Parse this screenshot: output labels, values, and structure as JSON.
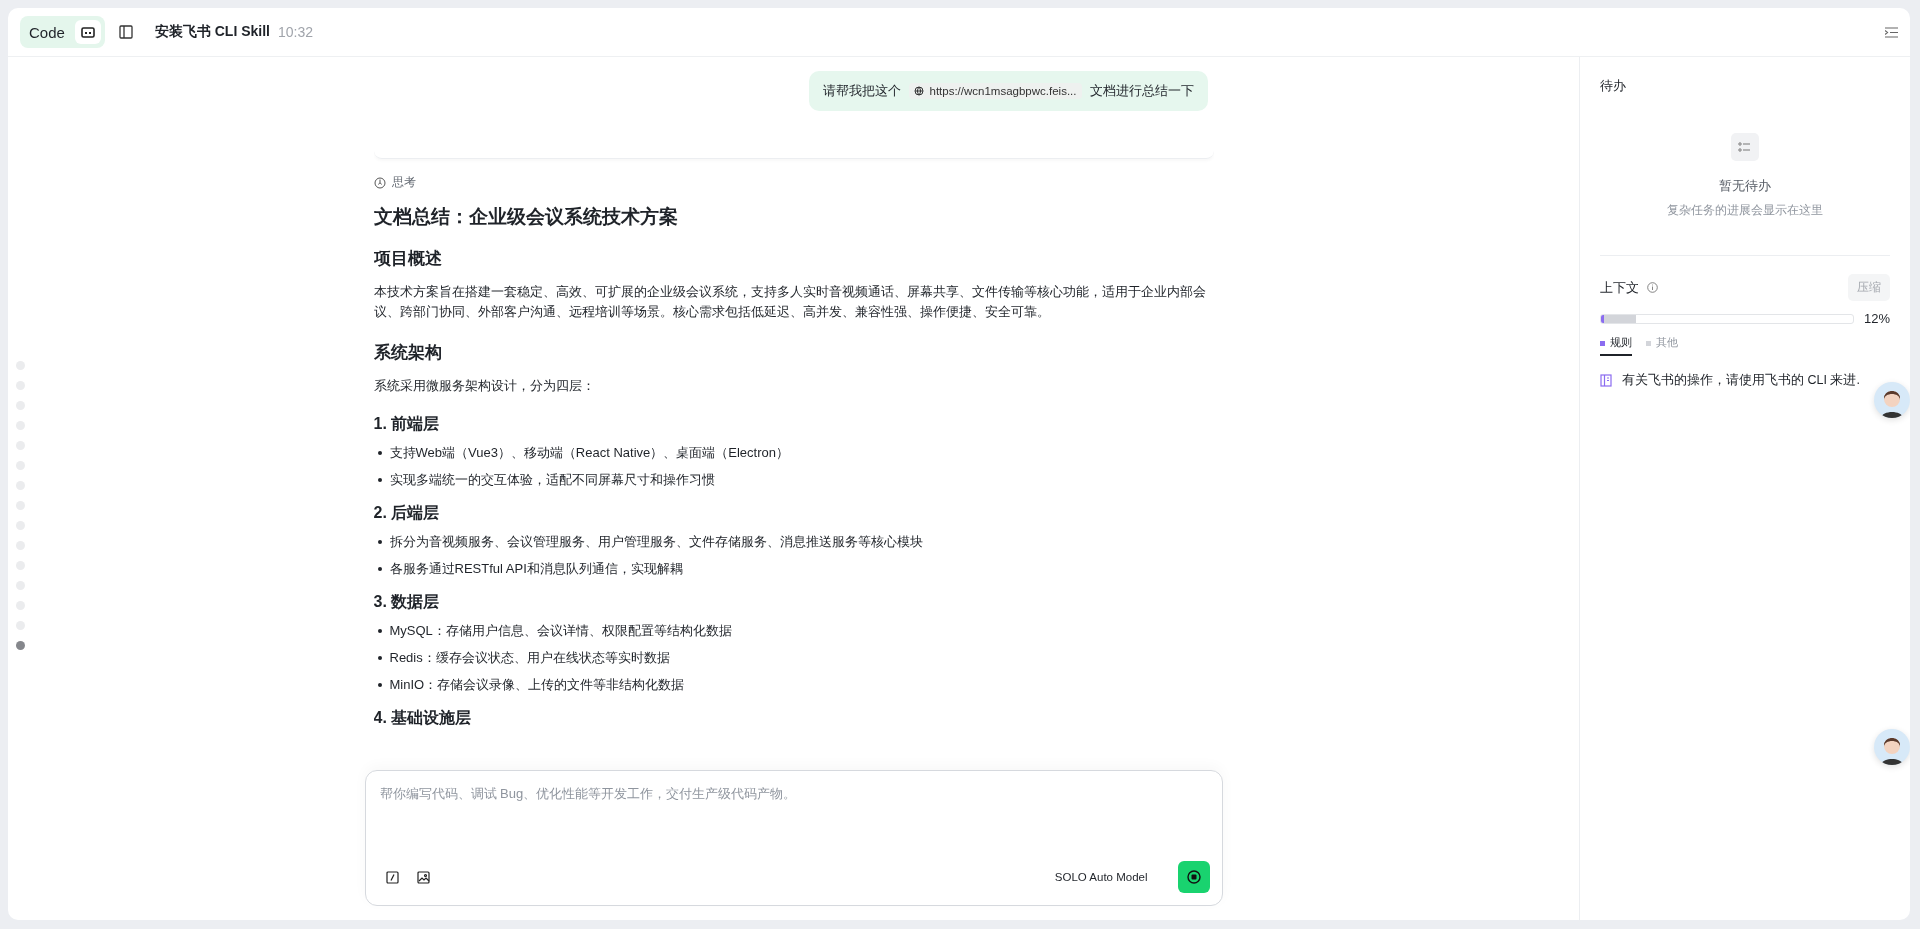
{
  "header": {
    "mode": "Code",
    "title": "安装飞书 CLI Skill",
    "time": "10:32"
  },
  "nav_dots": [
    {
      "selected": false
    },
    {
      "selected": false
    },
    {
      "selected": false
    },
    {
      "selected": false
    },
    {
      "selected": false
    },
    {
      "selected": false
    },
    {
      "selected": false
    },
    {
      "selected": false
    },
    {
      "selected": false
    },
    {
      "selected": false
    },
    {
      "selected": false
    },
    {
      "selected": false
    },
    {
      "selected": false
    },
    {
      "selected": false
    },
    {
      "selected": true
    }
  ],
  "user_message": [
    {
      "kind": "text",
      "text": "请帮我把这个"
    },
    {
      "kind": "link",
      "text": "https://wcn1msagbpwc.feis..."
    },
    {
      "kind": "text",
      "text": "文档进行总结一下"
    }
  ],
  "thinking_label": "思考",
  "document": [
    {
      "kind": "h1",
      "text": "文档总结：企业级会议系统技术方案"
    },
    {
      "kind": "h2",
      "text": "项目概述"
    },
    {
      "kind": "p",
      "text": "本技术方案旨在搭建一套稳定、高效、可扩展的企业级会议系统，支持多人实时音视频通话、屏幕共享、文件传输等核心功能，适用于企业内部会议、跨部门协同、外部客户沟通、远程培训等场景。核心需求包括低延迟、高并发、兼容性强、操作便捷、安全可靠。"
    },
    {
      "kind": "h2",
      "text": "系统架构"
    },
    {
      "kind": "p",
      "text": "系统采用微服务架构设计，分为四层："
    },
    {
      "kind": "h3",
      "text": "1. 前端层"
    },
    {
      "kind": "li",
      "text": "支持Web端（Vue3）、移动端（React Native）、桌面端（Electron）"
    },
    {
      "kind": "li",
      "text": "实现多端统一的交互体验，适配不同屏幕尺寸和操作习惯"
    },
    {
      "kind": "h3",
      "text": "2. 后端层"
    },
    {
      "kind": "li",
      "text": "拆分为音视频服务、会议管理服务、用户管理服务、文件存储服务、消息推送服务等核心模块"
    },
    {
      "kind": "li",
      "text": "各服务通过RESTful API和消息队列通信，实现解耦"
    },
    {
      "kind": "h3",
      "text": "3. 数据层"
    },
    {
      "kind": "li",
      "text": "MySQL：存储用户信息、会议详情、权限配置等结构化数据"
    },
    {
      "kind": "li",
      "text": "Redis：缓存会议状态、用户在线状态等实时数据"
    },
    {
      "kind": "li",
      "text": "MinIO：存储会议录像、上传的文件等非结构化数据"
    },
    {
      "kind": "h3",
      "text": "4. 基础设施层"
    }
  ],
  "composer": {
    "placeholder": "帮你编写代码、调试 Bug、优化性能等开发工作，交付生产级代码产物。",
    "model": "SOLO Auto Model"
  },
  "todo": {
    "title": "待办",
    "empty_title": "暂无待办",
    "empty_hint": "复杂任务的进展会显示在这里"
  },
  "context": {
    "title": "上下文",
    "compress_button": "压缩",
    "segments": [
      {
        "color": "#8b6cf0",
        "level": 0.012
      },
      {
        "color": "#d3d5da",
        "level": 0.125
      }
    ],
    "reading": "12%",
    "legend": [
      {
        "label": "规则",
        "color": "#8b6cf0",
        "selected": true
      },
      {
        "label": "其他",
        "color": "#d3d5da",
        "selected": false
      }
    ],
    "rules": [
      "有关飞书的操作，请使用飞书的 CLI 来进."
    ]
  }
}
